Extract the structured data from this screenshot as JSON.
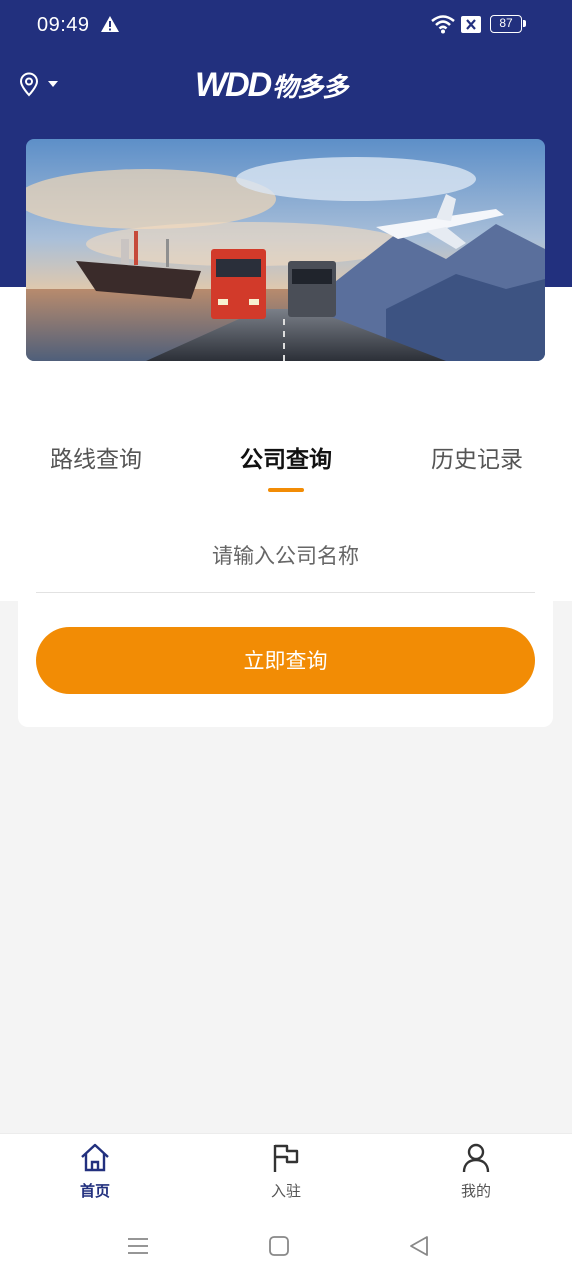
{
  "status_bar": {
    "time": "09:49",
    "battery": "87"
  },
  "header": {
    "location_icon": "location-pin-icon",
    "logo_latin": "WDD",
    "logo_cn": "物多多"
  },
  "banner": {
    "image": "logistics-banner (ship, trucks, airplane)"
  },
  "tabs": [
    {
      "label": "路线查询",
      "active": false
    },
    {
      "label": "公司查询",
      "active": true
    },
    {
      "label": "历史记录",
      "active": false
    }
  ],
  "search": {
    "placeholder": "请输入公司名称",
    "value": ""
  },
  "query_button": {
    "label": "立即查询"
  },
  "bottom_nav": [
    {
      "label": "首页",
      "icon": "home-icon",
      "active": true
    },
    {
      "label": "入驻",
      "icon": "flag-icon",
      "active": false
    },
    {
      "label": "我的",
      "icon": "user-icon",
      "active": false
    }
  ],
  "system_nav": [
    "menu-icon",
    "home-square-icon",
    "back-triangle-icon"
  ],
  "colors": {
    "header": "#22307e",
    "accent": "#f28c05",
    "background": "#f4f4f4"
  }
}
